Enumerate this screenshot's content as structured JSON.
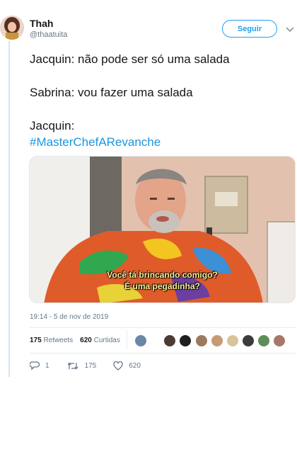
{
  "author": {
    "name": "Thah",
    "handle": "@thaatuita"
  },
  "follow_label": "Seguir",
  "tweet": {
    "line1": "Jacquin: não pode ser só uma salada",
    "line2": "Sabrina: vou fazer uma salada",
    "line3": "Jacquin:",
    "hashtag": "#MasterChefARevanche"
  },
  "media": {
    "subtitle_line1": "Você tá brincando comigo?",
    "subtitle_line2": "É uma pegadinha?"
  },
  "timestamp": "19:14 - 5 de nov de 2019",
  "stats": {
    "retweets_count": "175",
    "retweets_label": "Retweets",
    "likes_count": "620",
    "likes_label": "Curtidas"
  },
  "actions": {
    "reply_count": "1",
    "retweet_count": "175",
    "like_count": "620"
  },
  "icons": {
    "reply": "reply-icon",
    "retweet": "retweet-icon",
    "like": "heart-icon",
    "more": "chevron-down-icon"
  },
  "colors": {
    "accent": "#1da1f2",
    "hashtag": "#1b95e0",
    "muted": "#657786",
    "rail": "#cfe6f7"
  }
}
